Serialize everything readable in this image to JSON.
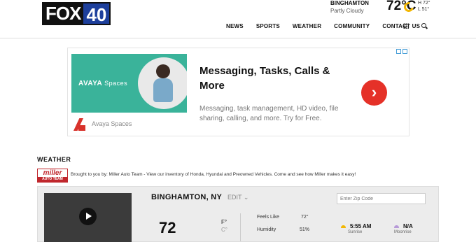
{
  "header": {
    "logo": {
      "part1": "FOX",
      "part2": "40"
    },
    "weather": {
      "city": "BINGHAMTON",
      "condition": "Partly Cloudy",
      "temp": "72°C",
      "high": "H 72°",
      "low": "L 51°",
      "icon": "partly-cloudy-sun-icon"
    },
    "nav": [
      "NEWS",
      "SPORTS",
      "WEATHER",
      "COMMUNITY",
      "CONTACT US"
    ],
    "icons": [
      "grid-menu-icon",
      "search-icon"
    ]
  },
  "ad": {
    "brand": "AVAYA",
    "brand_suffix": "Spaces",
    "title": "Messaging, Tasks, Calls & More",
    "description": "Messaging, task management, HD video, file sharing, calling, and more. Try for Free.",
    "source": "Avaya Spaces",
    "cta_icon": "chevron-right-icon",
    "close_icons": [
      "ad-info-icon",
      "ad-close-icon"
    ]
  },
  "weather_section": {
    "title": "WEATHER",
    "sponsor": {
      "logo_top": "miller",
      "logo_bottom": "AUTO TEAM",
      "text": "Brought to you by: Miller Auto Team - View our inventory of Honda, Hyundai and Preowned Vehicles. Come and see how Miller makes it easy!"
    },
    "panel": {
      "location": "BINGHAMTON, NY",
      "edit_label": "EDIT ⌄",
      "zip_placeholder": "Enter Zip Code",
      "current_temp": "72",
      "unit_f": "F°",
      "unit_c": "C°",
      "feels_like_label": "Feels Like",
      "feels_like_value": "72°",
      "humidity_label": "Humidity",
      "humidity_value": "51%",
      "sunrise_time": "5:55 AM",
      "sunrise_label": "Sunrise",
      "moon_value": "N/A",
      "moon_label": "Moonrise"
    }
  },
  "colors": {
    "brand_blue": "#1d3f9c",
    "ad_teal": "#3ab39a",
    "cta_red": "#e53128",
    "miller_red": "#c0272d",
    "sun": "#f2b705"
  }
}
